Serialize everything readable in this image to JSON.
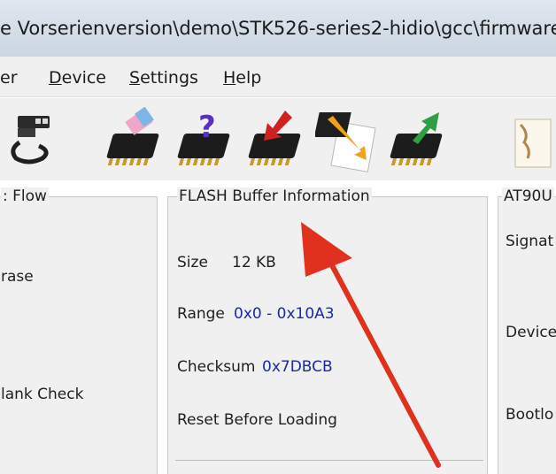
{
  "title": "e Vorserienversion\\demo\\STK526-series2-hidio\\gcc\\firmware",
  "menu": {
    "items": [
      {
        "label": "er"
      },
      {
        "label": "Device",
        "accel": "D"
      },
      {
        "label": "Settings",
        "accel": "S"
      },
      {
        "label": "Help",
        "accel": "H"
      }
    ]
  },
  "toolbar": {
    "items": [
      {
        "name": "usb-connect-icon"
      },
      {
        "name": "erase-device-icon"
      },
      {
        "name": "blank-check-icon"
      },
      {
        "name": "program-device-icon"
      },
      {
        "name": "verify-device-icon"
      },
      {
        "name": "read-device-icon"
      },
      {
        "name": "load-hex-icon"
      }
    ]
  },
  "left_panel": {
    "legend": ": Flow",
    "erase_label": "rase",
    "blank_check_label": "lank Check"
  },
  "flash_panel": {
    "legend": "FLASH Buffer Information",
    "size_label": "Size",
    "size_value": "12 KB",
    "range_label": "Range",
    "range_value": "0x0 - 0x10A3",
    "checksum_label": "Checksum",
    "checksum_value": "0x7DBCB",
    "reset_label": "Reset Before Loading"
  },
  "right_panel": {
    "legend": "AT90U",
    "signature_label": "Signat",
    "device_label": "Device",
    "bootloader_label": "Bootlo"
  },
  "colors": {
    "value_text": "#1a2aa0",
    "arrow": "#e0301e",
    "panel_bg": "#f0f0f0"
  }
}
